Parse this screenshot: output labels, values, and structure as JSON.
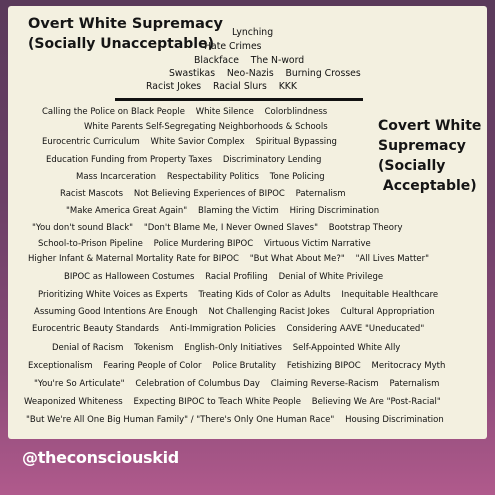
{
  "overt": {
    "title": "Overt White Supremacy",
    "subtitle": "(Socially Unacceptable)",
    "lines": [
      "Lynching",
      "Hate Crimes",
      "Blackface    The N-word",
      "Swastikas    Neo-Nazis    Burning Crosses",
      "Racist Jokes    Racial Slurs    KKK"
    ]
  },
  "covert": {
    "title_lines": [
      "Covert White",
      "Supremacy",
      "(Socially",
      " Acceptable)"
    ],
    "lines": [
      "Calling the Police on Black People    White Silence    Colorblindness",
      "White Parents Self-Segregating Neighborhoods & Schools",
      "Eurocentric Curriculum    White Savior Complex    Spiritual Bypassing",
      "Education Funding from Property Taxes    Discriminatory Lending",
      "Mass Incarceration    Respectability Politics    Tone Policing",
      "Racist Mascots    Not Believing Experiences of BIPOC    Paternalism",
      "\"Make America Great Again\"    Blaming the Victim    Hiring Discrimination",
      "\"You don't sound Black\"    \"Don't Blame Me, I Never Owned Slaves\"    Bootstrap Theory",
      "School-to-Prison Pipeline    Police Murdering BIPOC    Virtuous Victim Narrative",
      "Higher Infant & Maternal Mortality Rate for BIPOC    \"But What About Me?\"    \"All Lives Matter\"",
      "BIPOC as Halloween Costumes    Racial Profiling    Denial of White Privilege",
      "Prioritizing White Voices as Experts    Treating Kids of Color as Adults    Inequitable Healthcare",
      "Assuming Good Intentions Are Enough    Not Challenging Racist Jokes    Cultural Appropriation",
      "Eurocentric Beauty Standards    Anti-Immigration Policies    Considering AAVE \"Uneducated\"",
      "Denial of Racism    Tokenism    English-Only Initiatives    Self-Appointed White Ally",
      "Exceptionalism    Fearing People of Color    Police Brutality    Fetishizing BIPOC    Meritocracy Myth",
      "\"You're So Articulate\"    Celebration of Columbus Day    Claiming Reverse-Racism    Paternalism",
      "Weaponized Whiteness    Expecting BIPOC to Teach White People    Believing We Are \"Post-Racial\"",
      "\"But We're All One Big Human Family\" / \"There's Only One Human Race\"    Housing Discrimination"
    ]
  },
  "footer": {
    "handle": "@theconsciouskid"
  },
  "colors": {
    "card": "#f3f0e0",
    "text": "#111111",
    "divider": "#111111",
    "handle": "#ffffff"
  }
}
